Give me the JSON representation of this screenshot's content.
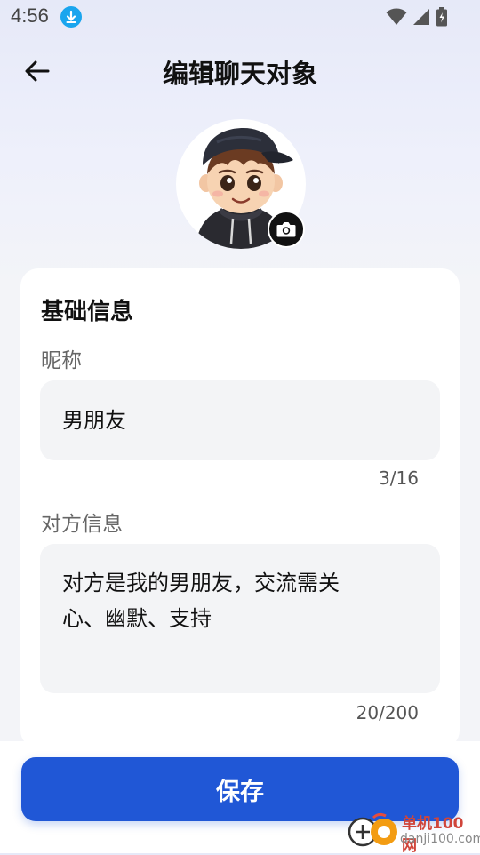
{
  "status_bar": {
    "time": "4:56"
  },
  "header": {
    "title": "编辑聊天对象"
  },
  "card": {
    "title": "基础信息",
    "nickname": {
      "label": "昵称",
      "value": "男朋友",
      "counter": "3/16"
    },
    "info": {
      "label": "对方信息",
      "line1": "对方是我的男朋友，交流需关",
      "line2": "心、幽默、支持",
      "counter": "20/200"
    }
  },
  "save_label": "保存",
  "watermark": {
    "name": "单机100网",
    "url": "danji100.com"
  },
  "colors": {
    "accent": "#2057d6",
    "background": "#f3f4f8"
  },
  "icons": [
    "back-arrow-icon",
    "download-icon",
    "wifi-icon",
    "signal-icon",
    "battery-icon",
    "camera-icon"
  ]
}
